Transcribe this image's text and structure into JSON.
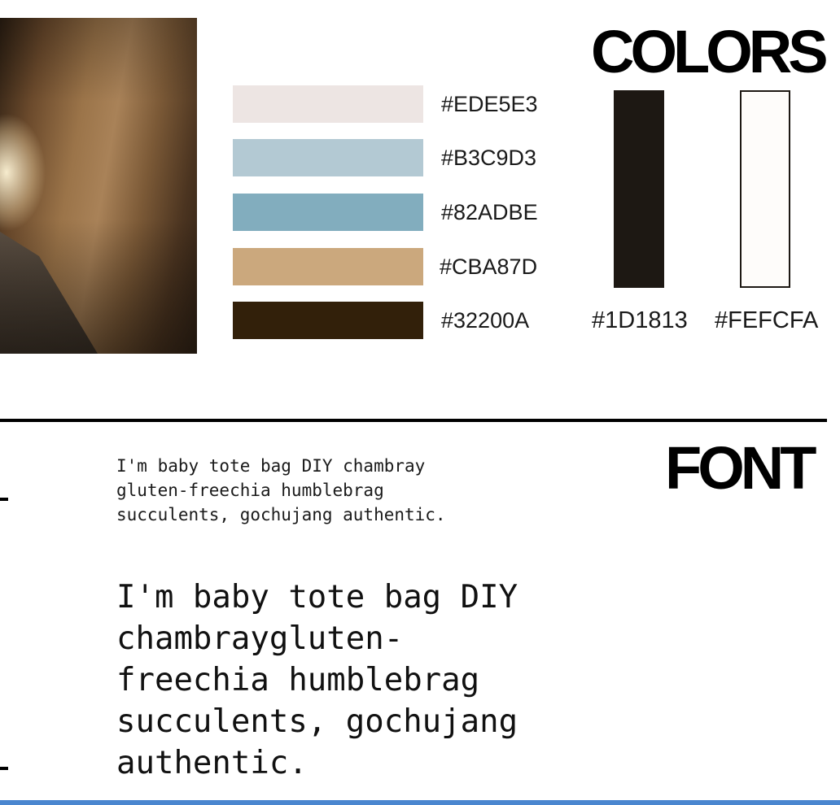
{
  "palette": {
    "swatches": [
      {
        "hex_label": "#EDE5E3",
        "color": "#EDE5E3"
      },
      {
        "hex_label": "#B3C9D3",
        "color": "#B3C9D3"
      },
      {
        "hex_label": "#82ADBE",
        "color": "#82ADBE"
      },
      {
        "hex_label": "#CBA87D",
        "color": "#CBA87D"
      },
      {
        "hex_label": "#32200A",
        "color": "#32200A"
      }
    ],
    "title": "COLORS",
    "neutrals": [
      {
        "hex_label": "#1D1813",
        "color": "#1D1813"
      },
      {
        "hex_label": "#FEFCFA",
        "color": "#FEFCFA"
      }
    ]
  },
  "font": {
    "title": "FONT",
    "sample_small": "I'm baby tote bag DIY chambray gluten-freechia humblebrag succulents, gochujang authentic.",
    "sample_large": "I'm baby tote bag DIY chambraygluten-freechia humblebrag succulents, gochujang authentic."
  },
  "colors": {
    "divider": "#000000",
    "accent_bottom": "#4A86CF"
  }
}
